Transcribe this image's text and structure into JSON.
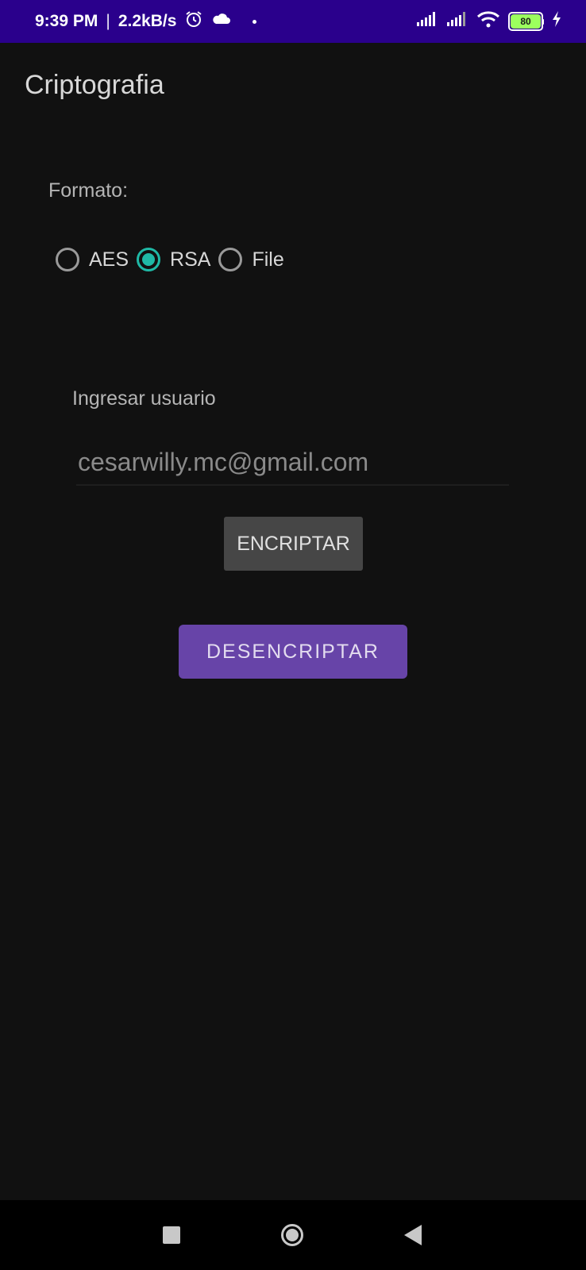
{
  "status_bar": {
    "time": "9:39 PM",
    "separator": "|",
    "network_speed": "2.2kB/s",
    "battery_level": "80",
    "icons": [
      "alarm-icon",
      "cloud-icon",
      "notification-dot",
      "signal-icon",
      "signal-icon",
      "wifi-icon",
      "battery-icon",
      "charging-icon"
    ]
  },
  "app": {
    "title": "Criptografia"
  },
  "format": {
    "label": "Formato:",
    "options": [
      {
        "label": "AES",
        "checked": false
      },
      {
        "label": "RSA",
        "checked": true
      },
      {
        "label": "File",
        "checked": false
      }
    ]
  },
  "user": {
    "label": "Ingresar usuario",
    "value": "cesarwilly.mc@gmail.com"
  },
  "buttons": {
    "encrypt": "ENCRIPTAR",
    "decrypt": "DESENCRIPTAR"
  },
  "colors": {
    "status_bar": "#2a008c",
    "background": "#111111",
    "radio_accent": "#1fb9a6",
    "decrypt_button": "#6744a8",
    "encrypt_button": "#464646"
  },
  "nav_bar": {
    "icons": [
      "recents-square-icon",
      "home-circle-icon",
      "back-triangle-icon"
    ]
  }
}
